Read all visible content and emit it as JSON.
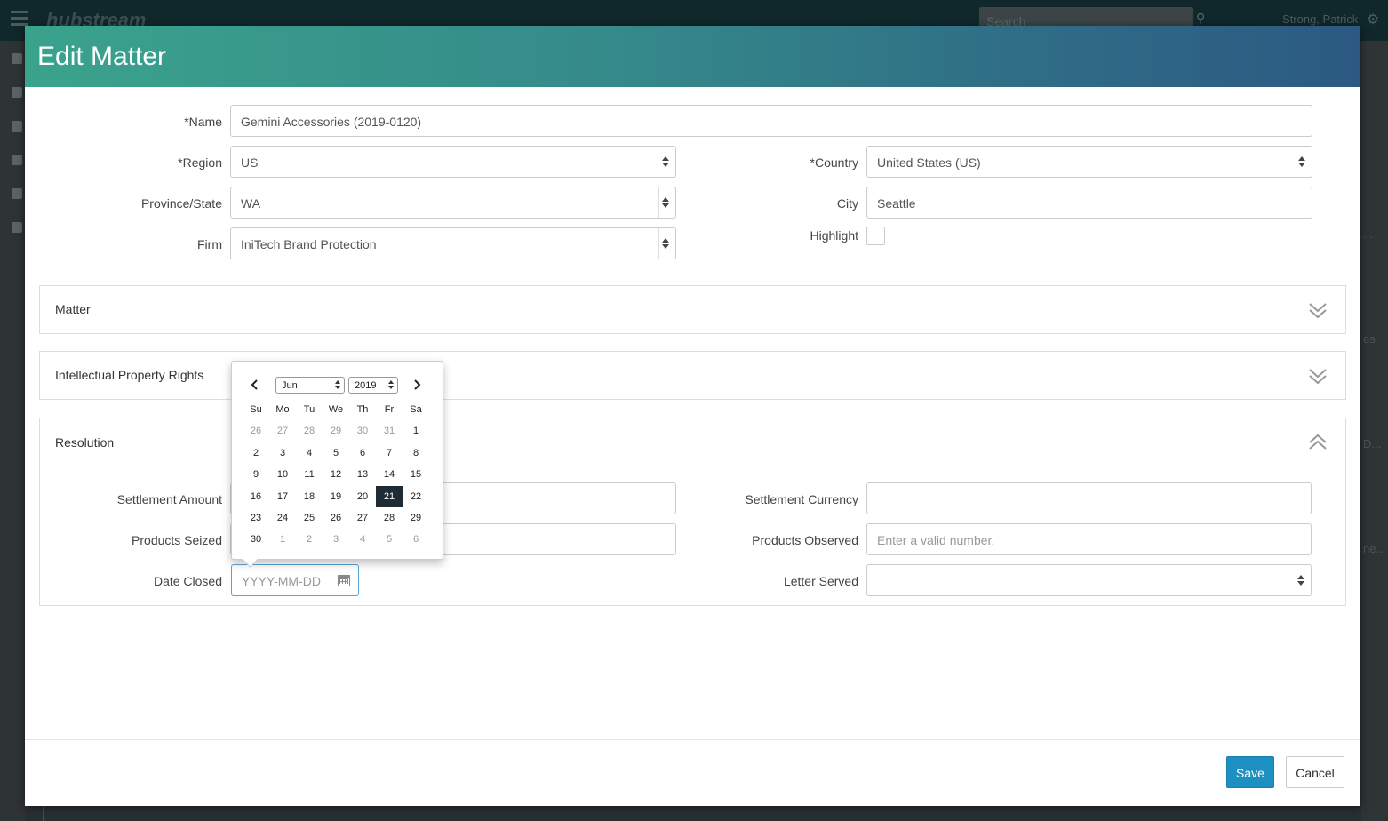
{
  "background": {
    "app_logo": "hubstream",
    "search_placeholder": "Search",
    "user_name": "Strong, Patrick",
    "right_fragments": [
      "...",
      "es",
      "D...",
      "ne..."
    ]
  },
  "modal": {
    "title": "Edit Matter",
    "fields": {
      "name": {
        "label": "*Name",
        "value": "Gemini Accessories (2019-0120)"
      },
      "region": {
        "label": "*Region",
        "value": "US"
      },
      "country": {
        "label": "*Country",
        "value": "United States (US)"
      },
      "province": {
        "label": "Province/State",
        "value": "WA"
      },
      "city": {
        "label": "City",
        "value": "Seattle"
      },
      "firm": {
        "label": "Firm",
        "value": "IniTech Brand Protection"
      },
      "highlight": {
        "label": "Highlight",
        "checked": false
      }
    },
    "panels": {
      "matter": "Matter",
      "ipr": "Intellectual Property Rights",
      "resolution": "Resolution"
    },
    "resolution": {
      "settlement_amount": {
        "label": "Settlement Amount",
        "value": ""
      },
      "settlement_currency": {
        "label": "Settlement Currency",
        "value": ""
      },
      "products_seized": {
        "label": "Products Seized",
        "value": ""
      },
      "products_observed": {
        "label": "Products Observed",
        "placeholder": "Enter a valid number."
      },
      "date_closed": {
        "label": "Date Closed",
        "placeholder": "YYYY-MM-DD"
      },
      "letter_served": {
        "label": "Letter Served",
        "value": ""
      }
    },
    "datepicker": {
      "month": "Jun",
      "year": "2019",
      "weekdays": [
        "Su",
        "Mo",
        "Tu",
        "We",
        "Th",
        "Fr",
        "Sa"
      ],
      "weeks": [
        [
          {
            "d": "26",
            "m": true
          },
          {
            "d": "27",
            "m": true
          },
          {
            "d": "28",
            "m": true
          },
          {
            "d": "29",
            "m": true
          },
          {
            "d": "30",
            "m": true
          },
          {
            "d": "31",
            "m": true
          },
          {
            "d": "1"
          }
        ],
        [
          {
            "d": "2"
          },
          {
            "d": "3"
          },
          {
            "d": "4"
          },
          {
            "d": "5"
          },
          {
            "d": "6"
          },
          {
            "d": "7"
          },
          {
            "d": "8"
          }
        ],
        [
          {
            "d": "9"
          },
          {
            "d": "10"
          },
          {
            "d": "11"
          },
          {
            "d": "12"
          },
          {
            "d": "13"
          },
          {
            "d": "14"
          },
          {
            "d": "15"
          }
        ],
        [
          {
            "d": "16"
          },
          {
            "d": "17"
          },
          {
            "d": "18"
          },
          {
            "d": "19"
          },
          {
            "d": "20"
          },
          {
            "d": "21",
            "a": true
          },
          {
            "d": "22"
          }
        ],
        [
          {
            "d": "23"
          },
          {
            "d": "24"
          },
          {
            "d": "25"
          },
          {
            "d": "26"
          },
          {
            "d": "27"
          },
          {
            "d": "28"
          },
          {
            "d": "29"
          }
        ],
        [
          {
            "d": "30"
          },
          {
            "d": "1",
            "m": true
          },
          {
            "d": "2",
            "m": true
          },
          {
            "d": "3",
            "m": true
          },
          {
            "d": "4",
            "m": true
          },
          {
            "d": "5",
            "m": true
          },
          {
            "d": "6",
            "m": true
          }
        ]
      ]
    },
    "buttons": {
      "save": "Save",
      "cancel": "Cancel"
    }
  },
  "colors": {
    "header_start": "#3aa38c",
    "header_end": "#2c5982",
    "primary_button": "#1e8fc1",
    "selected_day": "#1f2b35"
  }
}
